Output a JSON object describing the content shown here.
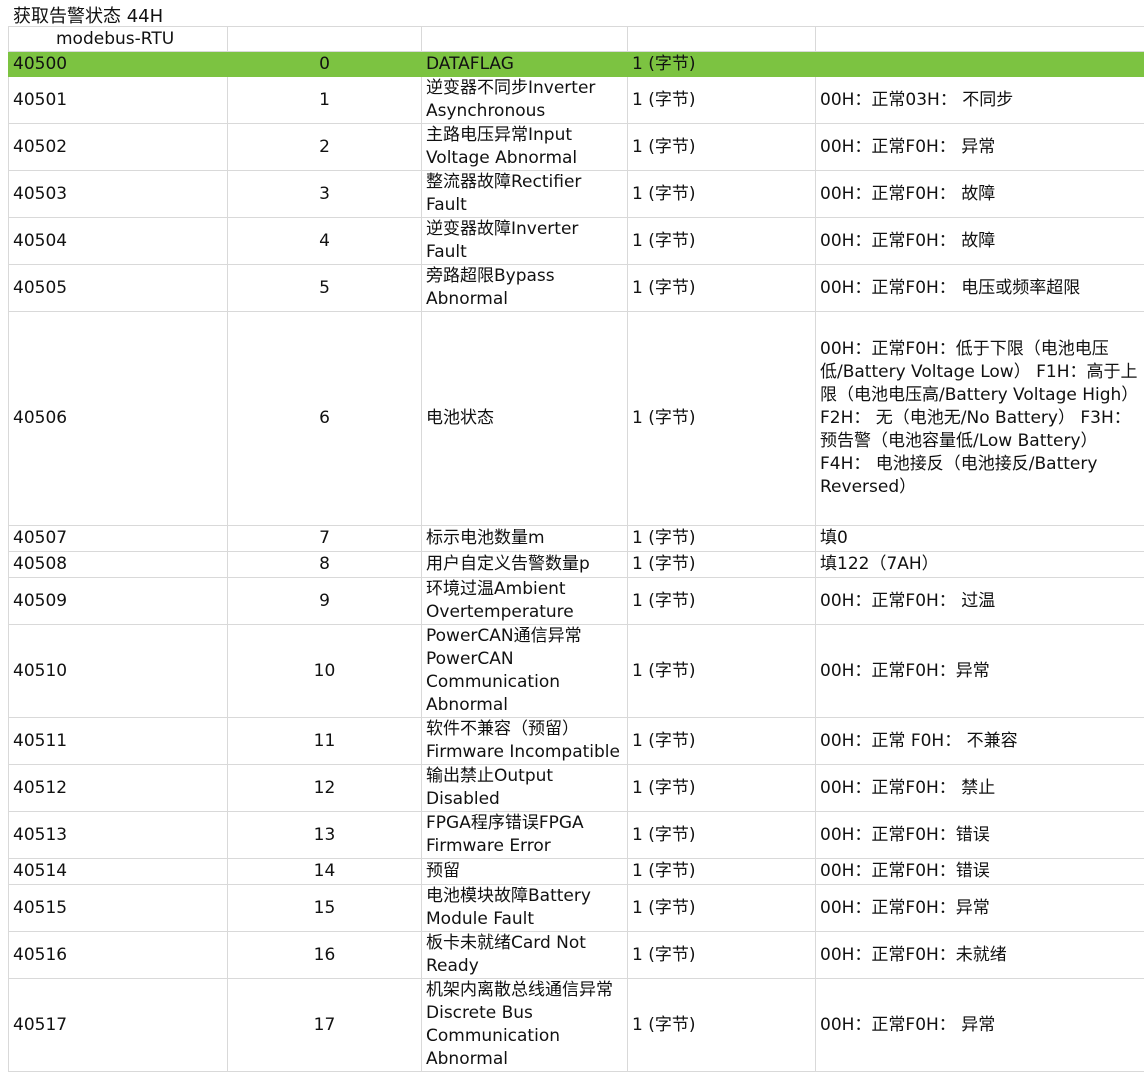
{
  "sheet": {
    "title": "获取告警状态 44H",
    "subtitle": "modebus-RTU",
    "highlight_color": "#7cc341",
    "rows": [
      {
        "reg": "40500",
        "idx": "0",
        "name": "DATAFLAG",
        "size": "1 (字节)",
        "desc": ""
      },
      {
        "reg": "40501",
        "idx": "1",
        "name": "逆变器不同步Inverter Asynchronous",
        "size": "1 (字节)",
        "desc": "00H：正常03H：  不同步"
      },
      {
        "reg": "40502",
        "idx": "2",
        "name": "主路电压异常Input Voltage Abnormal",
        "size": "1 (字节)",
        "desc": "00H：正常F0H：  异常"
      },
      {
        "reg": "40503",
        "idx": "3",
        "name": "整流器故障Rectifier Fault",
        "size": "1 (字节)",
        "desc": "00H：正常F0H：  故障"
      },
      {
        "reg": "40504",
        "idx": "4",
        "name": "逆变器故障Inverter Fault",
        "size": "1 (字节)",
        "desc": "00H：正常F0H：  故障"
      },
      {
        "reg": "40505",
        "idx": "5",
        "name": "旁路超限Bypass Abnormal",
        "size": "1 (字节)",
        "desc": "00H：正常F0H：  电压或频率超限"
      },
      {
        "reg": "40506",
        "idx": "6",
        "name": "电池状态",
        "size": "1 (字节)",
        "desc": "00H：正常F0H：低于下限（电池电压低/Battery Voltage Low） F1H：高于上限（电池电压高/Battery Voltage High） F2H：  无（电池无/No Battery） F3H：预告警（电池容量低/Low Battery） F4H：  电池接反（电池接反/Battery Reversed）"
      },
      {
        "reg": "40507",
        "idx": "7",
        "name": "标示电池数量m",
        "size": "1 (字节)",
        "desc": "填0"
      },
      {
        "reg": "40508",
        "idx": "8",
        "name": "用户自定义告警数量p",
        "size": "1 (字节)",
        "desc": "填122（7AH）"
      },
      {
        "reg": "40509",
        "idx": "9",
        "name": "环境过温Ambient Overtemperature",
        "size": "1 (字节)",
        "desc": "00H：正常F0H：  过温"
      },
      {
        "reg": "40510",
        "idx": "10",
        "name": "PowerCAN通信异常PowerCAN Communication Abnormal",
        "size": "1 (字节)",
        "desc": "00H：正常F0H：异常"
      },
      {
        "reg": "40511",
        "idx": "11",
        "name": "软件不兼容（预留）Firmware Incompatible",
        "size": "1 (字节)",
        "desc": "00H：正常 F0H：  不兼容"
      },
      {
        "reg": "40512",
        "idx": "12",
        "name": "输出禁止Output Disabled",
        "size": "1 (字节)",
        "desc": "00H：正常F0H：  禁止"
      },
      {
        "reg": "40513",
        "idx": "13",
        "name": "FPGA程序错误FPGA Firmware Error",
        "size": "1 (字节)",
        "desc": "00H：正常F0H：错误"
      },
      {
        "reg": "40514",
        "idx": "14",
        "name": "预留",
        "size": "1 (字节)",
        "desc": "00H：正常F0H：错误"
      },
      {
        "reg": "40515",
        "idx": "15",
        "name": "电池模块故障Battery Module Fault",
        "size": "1 (字节)",
        "desc": "00H：正常F0H：异常"
      },
      {
        "reg": "40516",
        "idx": "16",
        "name": "板卡未就绪Card Not Ready",
        "size": "1 (字节)",
        "desc": "00H：正常F0H：未就绪"
      },
      {
        "reg": "40517",
        "idx": "17",
        "name": "机架内离散总线通信异常Discrete Bus Communication Abnormal",
        "size": "1 (字节)",
        "desc": "00H：正常F0H：  异常"
      }
    ]
  }
}
